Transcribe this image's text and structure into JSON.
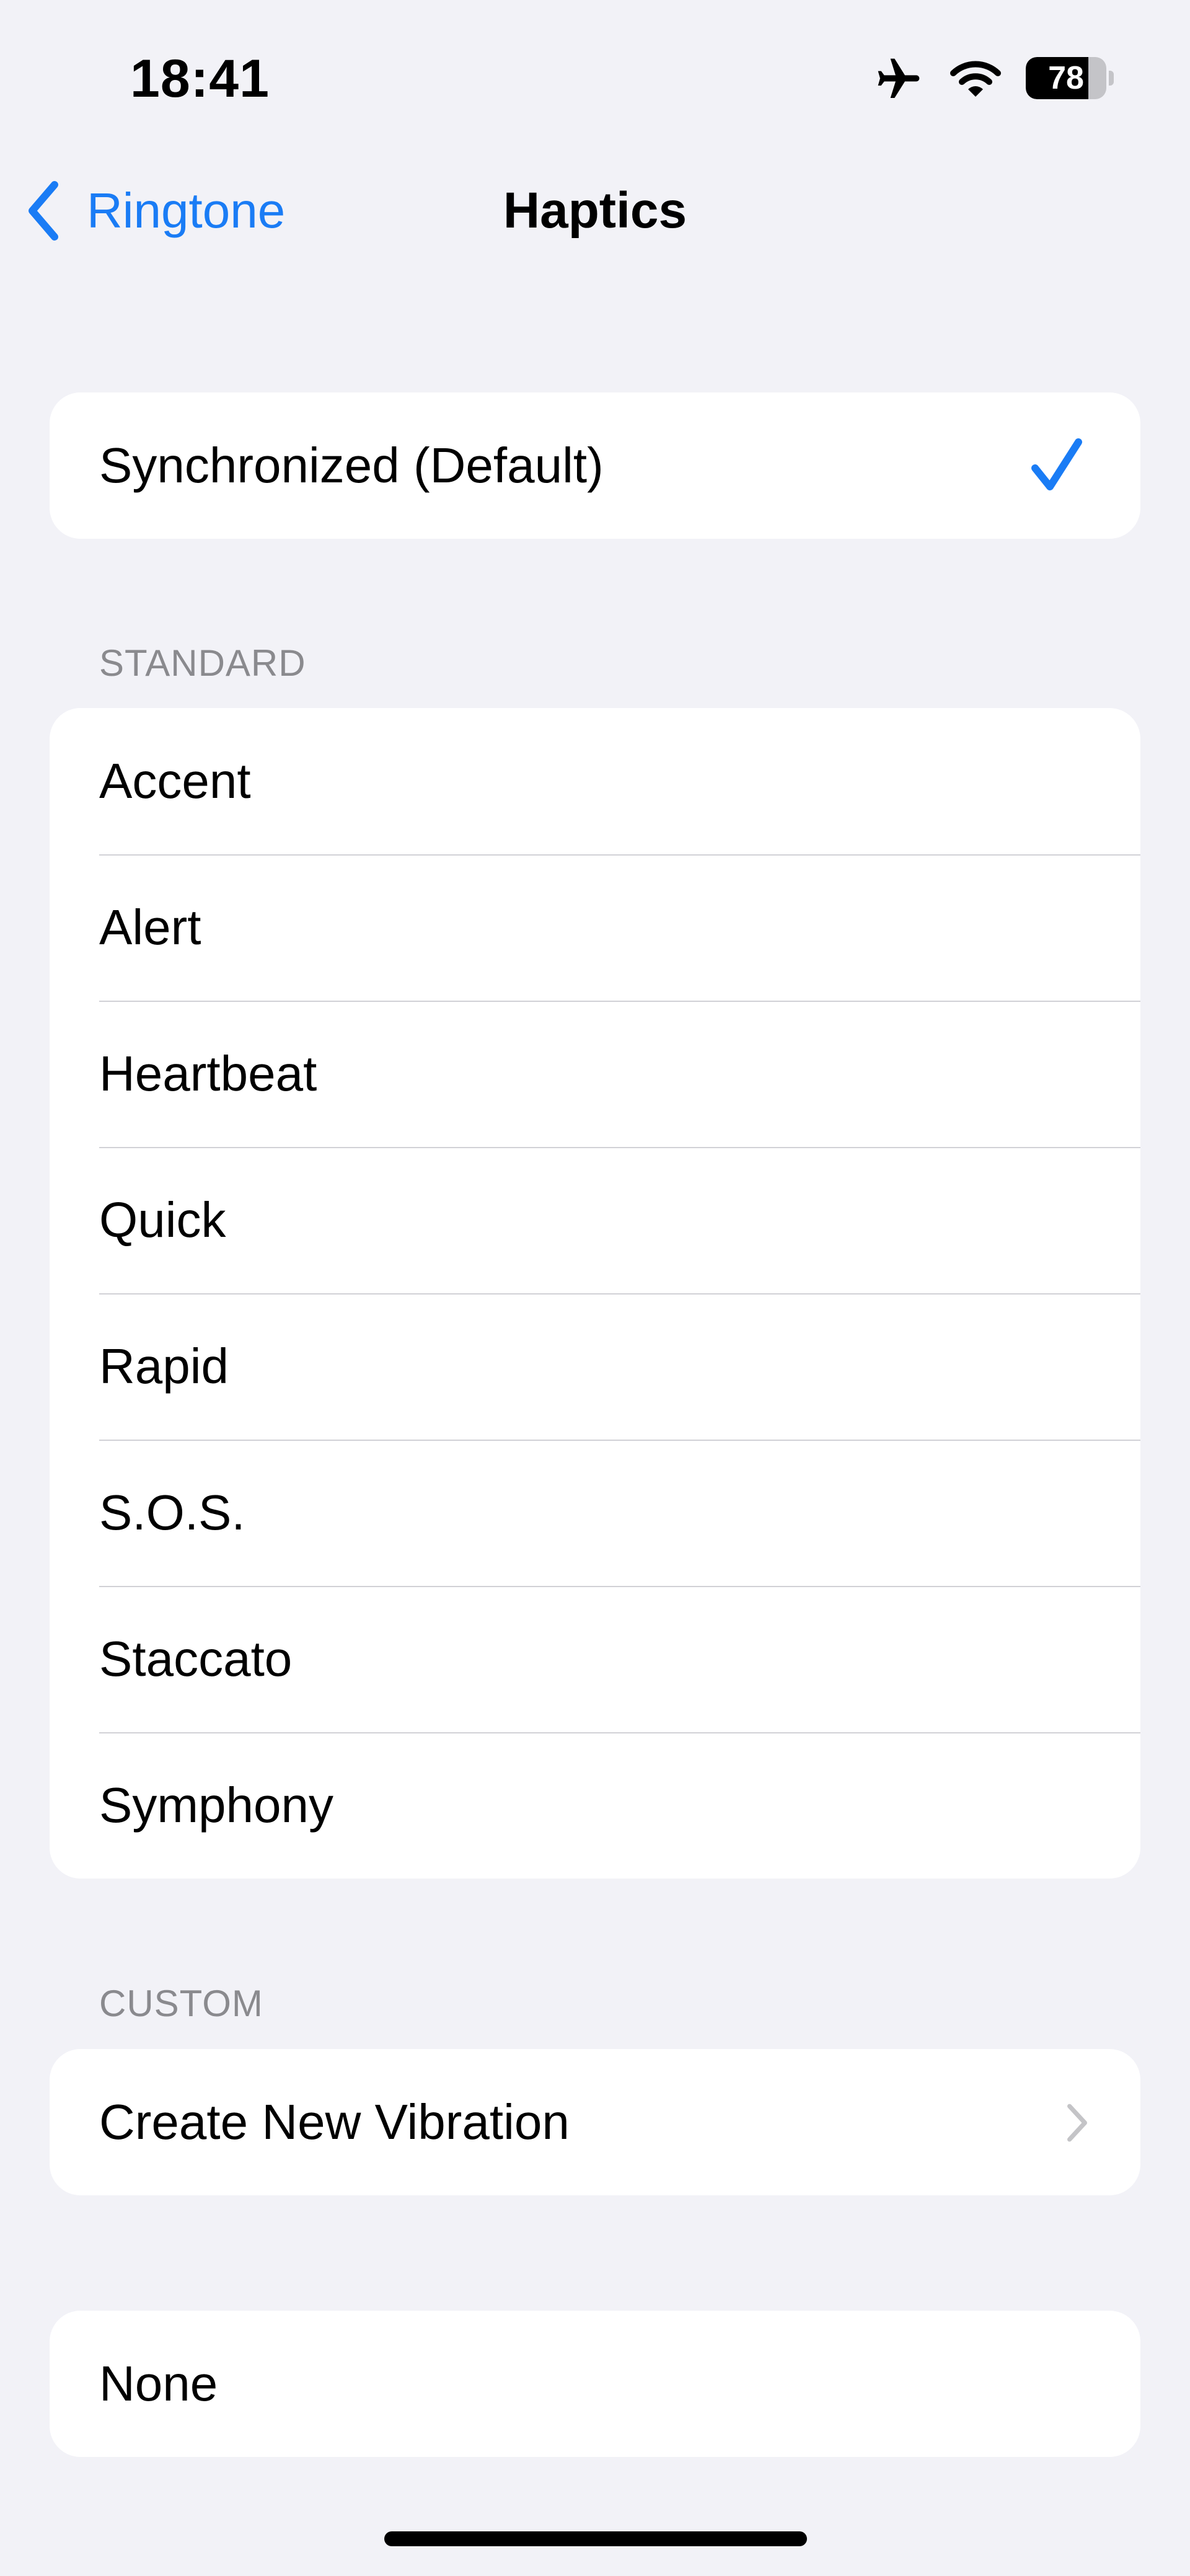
{
  "status_bar": {
    "time": "18:41",
    "battery_level": "78",
    "battery_percent": 78,
    "icons": [
      "airplane-icon",
      "wifi-icon",
      "battery-icon"
    ]
  },
  "nav": {
    "back_label": "Ringtone",
    "title": "Haptics"
  },
  "default_group": {
    "option": "Synchronized (Default)",
    "selected": true
  },
  "standard": {
    "header": "STANDARD",
    "items": [
      {
        "label": "Accent"
      },
      {
        "label": "Alert"
      },
      {
        "label": "Heartbeat"
      },
      {
        "label": "Quick"
      },
      {
        "label": "Rapid"
      },
      {
        "label": "S.O.S."
      },
      {
        "label": "Staccato"
      },
      {
        "label": "Symphony"
      }
    ]
  },
  "custom": {
    "header": "CUSTOM",
    "create_label": "Create New Vibration"
  },
  "none_group": {
    "label": "None"
  },
  "colors": {
    "accent": "#1a7cf5",
    "background": "#f2f2f7",
    "cell": "#ffffff",
    "separator": "#d1d1d6",
    "secondary_text": "#8a8a8e"
  }
}
